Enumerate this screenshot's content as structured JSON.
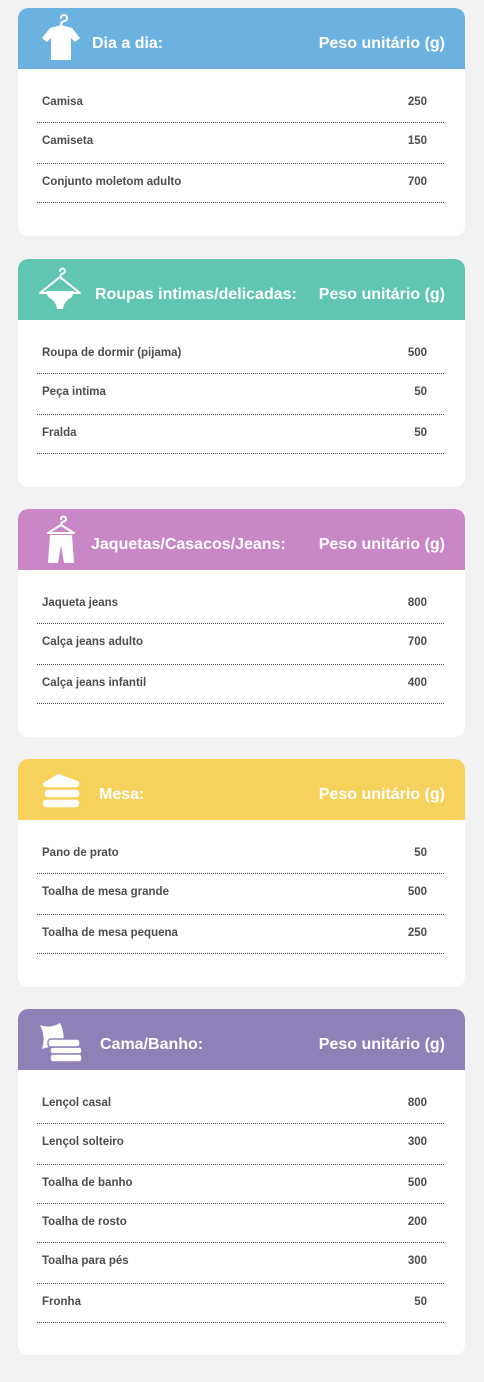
{
  "colors": {
    "background": "#f2f2f2",
    "dia_a_dia": "#6cb2e0",
    "intimas": "#60c6b2",
    "jaquetas": "#c987c8",
    "mesa": "#f6d15b",
    "cama": "#9080b8"
  },
  "sections": [
    {
      "title": "Dia a dia:",
      "column": "Peso unitário (g)",
      "icon": "shirt-hanger-icon",
      "items": [
        {
          "label": "Camisa",
          "value": "250"
        },
        {
          "label": "Camiseta",
          "value": "150"
        },
        {
          "label": "Conjunto moletom adulto",
          "value": "700"
        }
      ]
    },
    {
      "title": "Roupas intimas/delicadas:",
      "column": "Peso unitário (g)",
      "icon": "underwear-hanger-icon",
      "items": [
        {
          "label": "Roupa de dormir (pijama)",
          "value": "500"
        },
        {
          "label": "Peça intima",
          "value": "50"
        },
        {
          "label": "Fralda",
          "value": "50"
        }
      ]
    },
    {
      "title": "Jaquetas/Casacos/Jeans:",
      "column": "Peso unitário (g)",
      "icon": "pants-hanger-icon",
      "items": [
        {
          "label": "Jaqueta jeans",
          "value": "800"
        },
        {
          "label": "Calça jeans adulto",
          "value": "700"
        },
        {
          "label": "Calça jeans infantil",
          "value": "400"
        }
      ]
    },
    {
      "title": "Mesa:",
      "column": "Peso unitário (g)",
      "icon": "folded-towels-icon",
      "items": [
        {
          "label": "Pano de prato",
          "value": "50"
        },
        {
          "label": "Toalha de mesa grande",
          "value": "500"
        },
        {
          "label": "Toalha de mesa pequena",
          "value": "250"
        }
      ]
    },
    {
      "title": "Cama/Banho:",
      "column": "Peso unitário (g)",
      "icon": "pillow-towels-icon",
      "items": [
        {
          "label": "Lençol casal",
          "value": "800"
        },
        {
          "label": "Lençol solteiro",
          "value": "300"
        },
        {
          "label": "Toalha de banho",
          "value": "500"
        },
        {
          "label": "Toalha de rosto",
          "value": "200"
        },
        {
          "label": "Toalha para pés",
          "value": "300"
        },
        {
          "label": "Fronha",
          "value": "50"
        }
      ]
    }
  ]
}
